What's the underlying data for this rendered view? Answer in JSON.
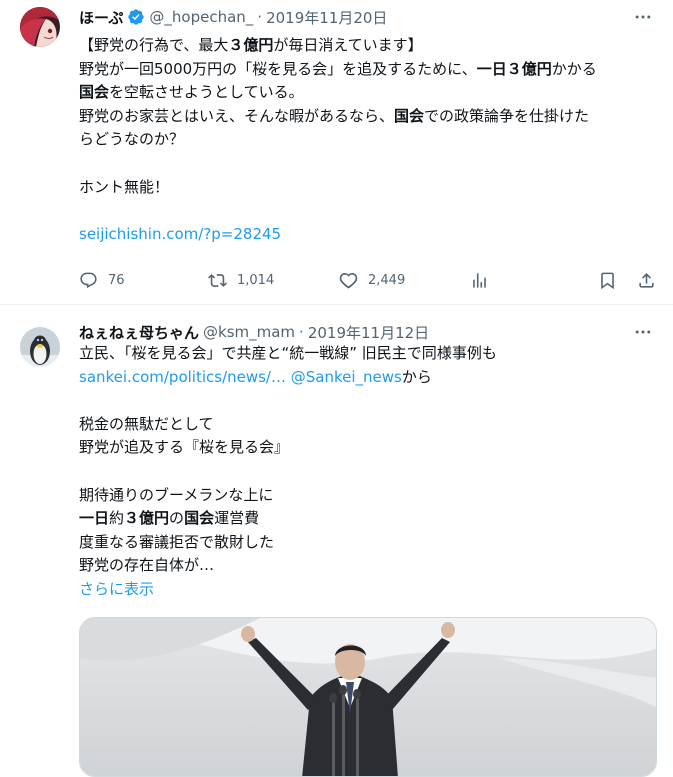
{
  "tweets": [
    {
      "author_name": "ほーぷ",
      "handle": "@_hopechan_",
      "separator": "·",
      "date": "2019年11月20日",
      "verified": true,
      "lines": [
        {
          "segments": [
            {
              "t": "【野党の行為で、最大",
              "b": false
            },
            {
              "t": "３億円",
              "b": true
            },
            {
              "t": "が毎日消えています】",
              "b": false
            }
          ]
        },
        {
          "segments": [
            {
              "t": "野党が一回5000万円の「桜を見る会」を追及するために、",
              "b": false
            },
            {
              "t": "一日３億円",
              "b": true
            },
            {
              "t": "かかる",
              "b": false
            }
          ]
        },
        {
          "segments": [
            {
              "t": "国会",
              "b": true
            },
            {
              "t": "を空転させようとしている。",
              "b": false
            }
          ]
        },
        {
          "segments": [
            {
              "t": "野党のお家芸とはいえ、そんな暇があるなら、",
              "b": false
            },
            {
              "t": "国会",
              "b": true
            },
            {
              "t": "での政策論争を仕掛けた",
              "b": false
            }
          ]
        },
        {
          "segments": [
            {
              "t": "らどうなのか？",
              "b": false
            }
          ]
        },
        {
          "gap": true
        },
        {
          "segments": [
            {
              "t": "ホント無能！",
              "b": false
            }
          ]
        },
        {
          "gap": true
        },
        {
          "segments": [
            {
              "t": "seijichishin.com/?p=28245",
              "b": false,
              "link": true
            }
          ]
        }
      ],
      "metrics": {
        "replies": "76",
        "retweets": "1,014",
        "likes": "2,449"
      }
    },
    {
      "author_name": "ねぇねぇ母ちゃん",
      "handle": "@ksm_mam",
      "separator": "·",
      "date": "2019年11月12日",
      "verified": false,
      "lines": [
        {
          "segments": [
            {
              "t": "立民、「桜を見る会」で共産と“統一戦線” 旧民主で同様事例も",
              "b": false
            }
          ]
        },
        {
          "segments": [
            {
              "t": "sankei.com/politics/news/…",
              "b": false,
              "link": true
            },
            {
              "t": " ",
              "b": false
            },
            {
              "t": "@Sankei_news",
              "b": false,
              "link": true
            },
            {
              "t": "から",
              "b": false
            }
          ]
        },
        {
          "gap": true
        },
        {
          "segments": [
            {
              "t": "税金の無駄だとして",
              "b": false
            }
          ]
        },
        {
          "segments": [
            {
              "t": "野党が追及する『桜を見る会』",
              "b": false
            }
          ]
        },
        {
          "gap": true
        },
        {
          "segments": [
            {
              "t": "期待通りのブーメランな上に",
              "b": false
            }
          ]
        },
        {
          "segments": [
            {
              "t": "一日",
              "b": true
            },
            {
              "t": "約",
              "b": false
            },
            {
              "t": "３億円",
              "b": true
            },
            {
              "t": "の",
              "b": false
            },
            {
              "t": "国会",
              "b": true
            },
            {
              "t": "運営費",
              "b": false
            }
          ]
        },
        {
          "segments": [
            {
              "t": "度重なる審議拒否で散財した",
              "b": false
            }
          ]
        },
        {
          "segments": [
            {
              "t": "野党の存在自体が…",
              "b": false
            }
          ]
        },
        {
          "segments": [
            {
              "t": "さらに表示",
              "b": false,
              "link": true
            }
          ]
        }
      ]
    }
  ],
  "colors": {
    "link": "#1d9bf0",
    "muted": "#536471",
    "verified": "#1d9bf0"
  }
}
